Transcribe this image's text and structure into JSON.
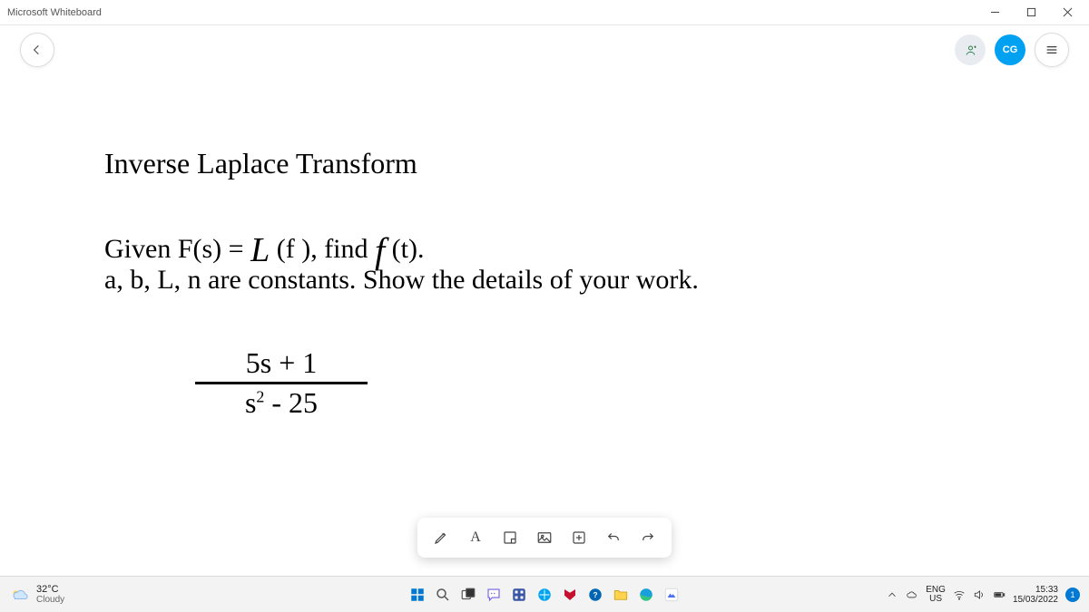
{
  "window": {
    "title": "Microsoft Whiteboard"
  },
  "header": {
    "user_initials": "CG"
  },
  "canvas": {
    "title": "Inverse Laplace Transform",
    "problem_prefix": "Given F(s) = ",
    "problem_mid": " (f ), find ",
    "problem_suffix": " (t).",
    "constants_line": "a, b, L, n are constants. Show the details of your work.",
    "frac_num": "5s + 1",
    "frac_den_s": "s",
    "frac_den_exp": "2",
    "frac_den_rest": " - 25"
  },
  "toolbar": {
    "text_label": "A"
  },
  "taskbar": {
    "temp": "32°C",
    "weather": "Cloudy",
    "lang_top": "ENG",
    "lang_bottom": "US",
    "time": "15:33",
    "date": "15/03/2022",
    "notif_count": "1"
  }
}
